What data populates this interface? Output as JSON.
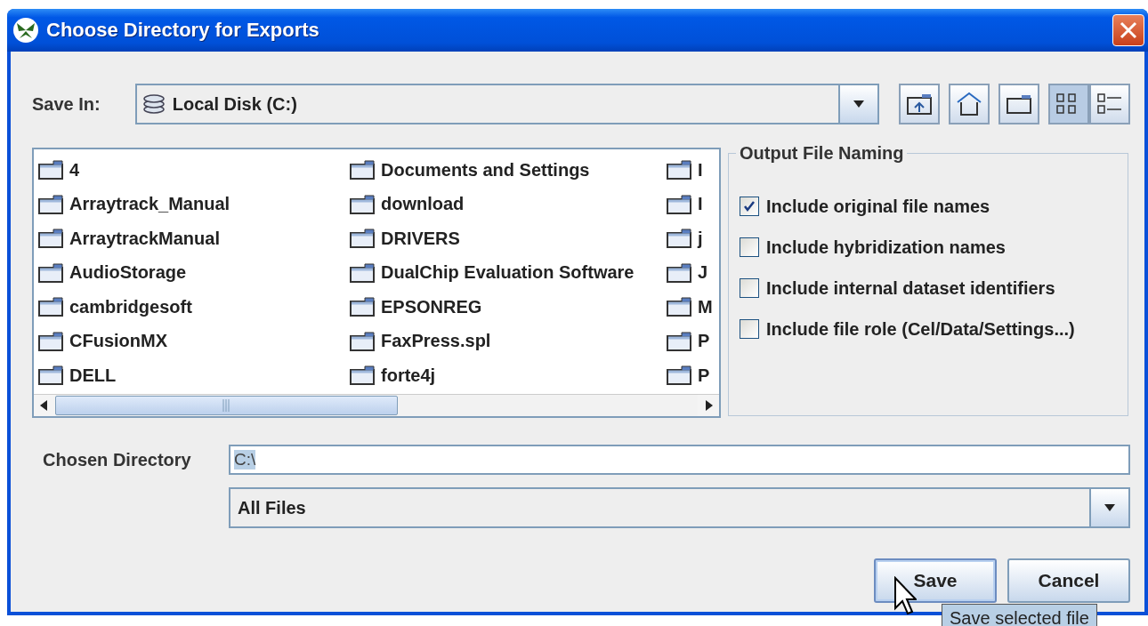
{
  "window": {
    "title": "Choose Directory for Exports"
  },
  "save_in": {
    "label": "Save In:",
    "value": "Local Disk (C:)"
  },
  "toolbar": [
    {
      "kind": "up",
      "selected": false
    },
    {
      "kind": "home",
      "selected": false
    },
    {
      "kind": "new-folder",
      "selected": false
    },
    {
      "kind": "list",
      "selected": true
    },
    {
      "kind": "details",
      "selected": false
    }
  ],
  "files": {
    "columns": [
      [
        "4",
        "Arraytrack_Manual",
        "ArraytrackManual",
        "AudioStorage",
        "cambridgesoft",
        "CFusionMX",
        "DELL"
      ],
      [
        "Documents and Settings",
        "download",
        "DRIVERS",
        "DualChip Evaluation Software",
        "EPSONREG",
        "FaxPress.spl",
        "forte4j"
      ],
      [
        "I",
        "I",
        "j",
        "J",
        "M",
        "P",
        "P"
      ]
    ]
  },
  "output_naming": {
    "title": "Output File Naming",
    "options": [
      {
        "label": "Include original file names",
        "checked": true
      },
      {
        "label": "Include hybridization names",
        "checked": false
      },
      {
        "label": "Include internal dataset identifiers",
        "checked": false
      },
      {
        "label": "Include file role (Cel/Data/Settings...)",
        "checked": false
      }
    ]
  },
  "chosen_directory": {
    "label": "Chosen Directory",
    "value": "C:\\"
  },
  "filter": {
    "value": "All Files"
  },
  "buttons": [
    {
      "label": "Save",
      "focused": true
    },
    {
      "label": "Cancel",
      "focused": false
    }
  ],
  "tooltip": "Save selected file"
}
